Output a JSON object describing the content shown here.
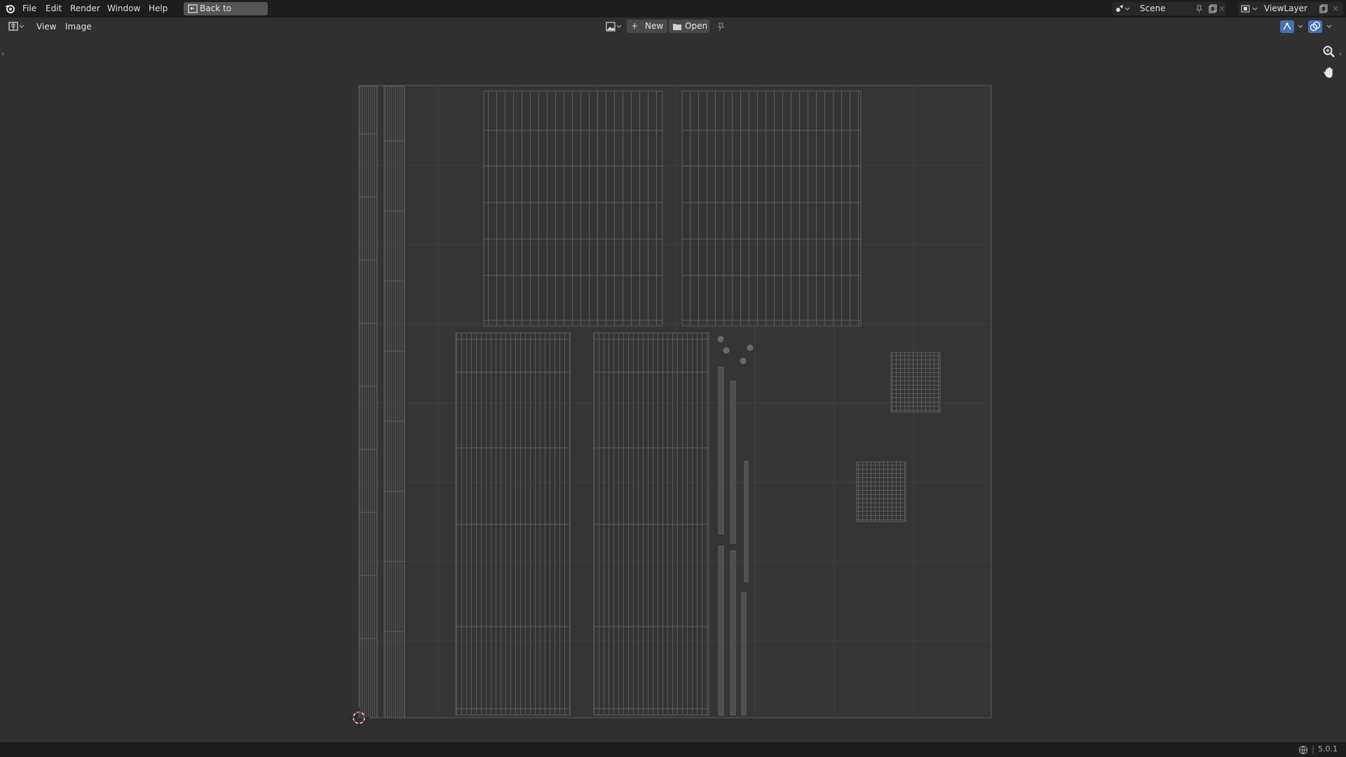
{
  "topbar": {
    "menus": [
      "File",
      "Edit",
      "Render",
      "Window",
      "Help"
    ],
    "back_label": "Back to Previous",
    "scene": "Scene",
    "view_layer": "ViewLayer"
  },
  "header": {
    "view_label": "View",
    "image_label": "Image",
    "new_label": "New",
    "open_label": "Open"
  },
  "status": {
    "version": "5.0.1"
  },
  "colors": {
    "background": "#303030",
    "topbar": "#1d1d1d",
    "uv_fill": "#383838",
    "uv_wire": "#5e5e5e",
    "accent_blue": "#4772b3"
  }
}
